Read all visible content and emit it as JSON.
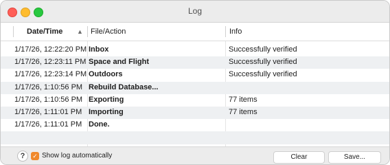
{
  "window": {
    "title": "Log"
  },
  "columns": {
    "date": "Date/Time",
    "file": "File/Action",
    "info": "Info",
    "sort_indicator": "▲"
  },
  "rows": [
    {
      "date": "1/17/26, 12:22:20 PM",
      "file": "Inbox",
      "info": "Successfully verified"
    },
    {
      "date": "1/17/26, 12:23:11 PM",
      "file": "Space and Flight",
      "info": "Successfully verified"
    },
    {
      "date": "1/17/26, 12:23:14 PM",
      "file": "Outdoors",
      "info": "Successfully verified"
    },
    {
      "date": "1/17/26, 1:10:56 PM",
      "file": "Rebuild Database...",
      "info": ""
    },
    {
      "date": "1/17/26, 1:10:56 PM",
      "file": "Exporting",
      "info": "77 items"
    },
    {
      "date": "1/17/26, 1:11:01 PM",
      "file": "Importing",
      "info": "77 items"
    },
    {
      "date": "1/17/26, 1:11:01 PM",
      "file": "Done.",
      "info": ""
    }
  ],
  "footer": {
    "help": "?",
    "checkbox_label": "Show log automatically",
    "checkbox_checked": true,
    "clear_label": "Clear",
    "save_label": "Save..."
  },
  "colors": {
    "accent": "#f0892c",
    "close": "#ff5f57",
    "minimize": "#febc2e",
    "maximize": "#28c840"
  },
  "icons": [
    "close-traffic-light-icon",
    "minimize-traffic-light-icon",
    "maximize-traffic-light-icon",
    "sort-ascending-icon",
    "help-icon",
    "checkmark-icon"
  ]
}
